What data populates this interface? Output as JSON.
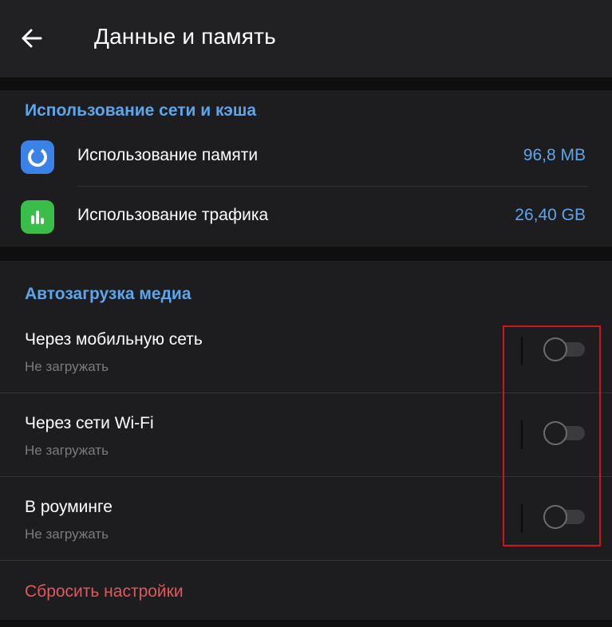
{
  "header": {
    "title": "Данные и память"
  },
  "network_cache": {
    "section_title": "Использование сети и кэша",
    "items": [
      {
        "label": "Использование памяти",
        "value": "96,8 MB",
        "icon": "storage-usage-icon",
        "icon_color": "#3b82e8"
      },
      {
        "label": "Использование трафика",
        "value": "26,40 GB",
        "icon": "traffic-usage-icon",
        "icon_color": "#3bbd4a"
      }
    ]
  },
  "autodownload": {
    "section_title": "Автозагрузка медиа",
    "items": [
      {
        "title": "Через мобильную сеть",
        "subtitle": "Не загружать",
        "enabled": false
      },
      {
        "title": "Через сети Wi-Fi",
        "subtitle": "Не загружать",
        "enabled": false
      },
      {
        "title": "В роуминге",
        "subtitle": "Не загружать",
        "enabled": false
      }
    ],
    "reset_label": "Сбросить настройки"
  },
  "colors": {
    "accent": "#5da5ea",
    "danger": "#e0585d",
    "highlight_box": "#d0141a",
    "background": "#1d1d1f"
  }
}
